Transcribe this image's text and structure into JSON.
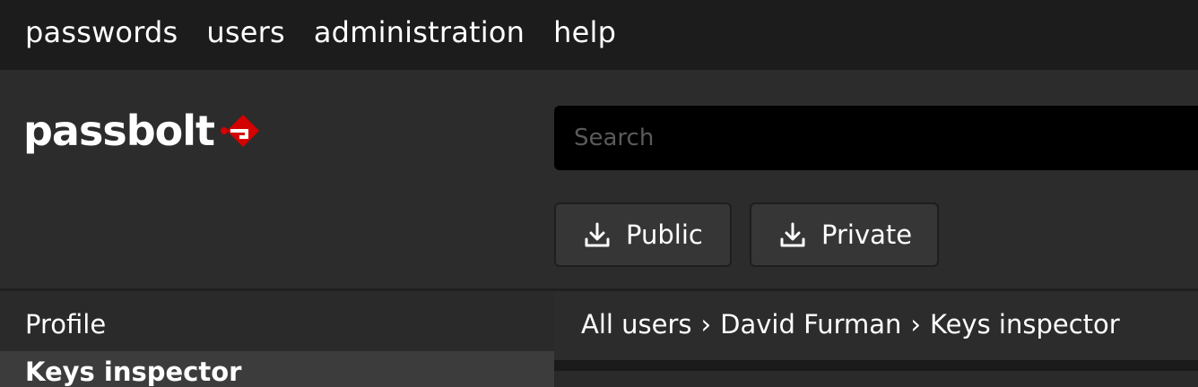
{
  "topnav": {
    "items": [
      {
        "label": "passwords"
      },
      {
        "label": "users"
      },
      {
        "label": "administration"
      },
      {
        "label": "help"
      }
    ]
  },
  "logo": {
    "text": "passbolt",
    "icon": "passbolt-key-icon",
    "accent_color": "#d40101"
  },
  "search": {
    "placeholder": "Search",
    "value": ""
  },
  "actions": {
    "public_label": "Public",
    "private_label": "Private",
    "icon": "download-icon"
  },
  "sidebar": {
    "items": [
      {
        "label": "Profile"
      },
      {
        "label": "Keys inspector"
      }
    ]
  },
  "breadcrumb": {
    "items": [
      {
        "label": "All users"
      },
      {
        "label": "David Furman"
      },
      {
        "label": "Keys inspector"
      }
    ],
    "separator": "›"
  },
  "colors": {
    "topnav_bg": "#1c1c1c",
    "header_bg": "#2c2c2c",
    "search_bg": "#000000",
    "button_bg": "#363636"
  }
}
